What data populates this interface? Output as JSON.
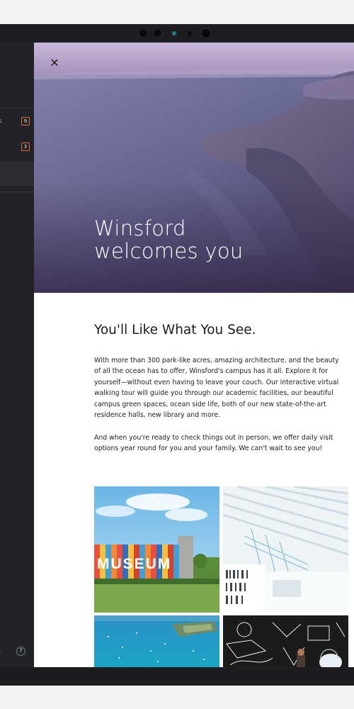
{
  "sidebar": {
    "items": [
      {
        "label_fragment": "s",
        "badge": "9"
      },
      {
        "label_fragment": "",
        "badge": "3"
      }
    ],
    "footer_arrow": "›",
    "help_glyph": "?"
  },
  "modal": {
    "close_glyph": "✕",
    "hero": {
      "title_line1": "Winsford",
      "title_line2": "welcomes you"
    },
    "heading": "You'll Like What You See.",
    "paragraphs": [
      "With more than 300 park-like acres, amazing architecture, and the beauty of all the ocean has to offer, Winsford's campus has it all. Explore it for yourself—without even having to leave your couch. Our interactive virtual walking tour will guide you through our academic facilities, our beautiful campus green spaces, ocean side life, both of our new state-of-the-art residence halls, new library and more.",
      "And when you're ready to check things out in person, we offer daily visit options year round for you and your family. We can't wait to see you!"
    ],
    "photos": [
      {
        "name": "museum-building-photo"
      },
      {
        "name": "library-interior-photo"
      },
      {
        "name": "harbor-aerial-photo"
      },
      {
        "name": "mural-street-art-photo"
      }
    ],
    "photo_sign_text": "MUSEUM"
  },
  "colors": {
    "sidebar_bg": "#212328",
    "badge_border": "#e36a3a",
    "hero_overlay": "#5a4a7a"
  }
}
